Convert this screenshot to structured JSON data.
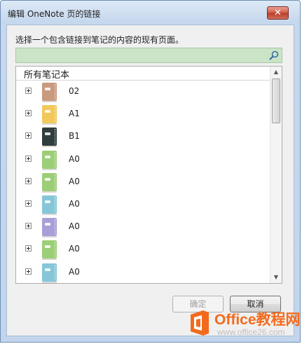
{
  "window": {
    "title": "编辑 OneNote 页的链接",
    "close_label": "✕"
  },
  "dialog": {
    "instruction": "选择一个包含链接到笔记的内容的现有页面。",
    "search": {
      "value": "",
      "placeholder": "",
      "icon": "search-icon"
    },
    "tree": {
      "header": "所有笔记本",
      "items": [
        {
          "label": "02",
          "color": "#c99a7e"
        },
        {
          "label": "A1",
          "color": "#f2c85b"
        },
        {
          "label": "B1",
          "color": "#2f3e3c"
        },
        {
          "label": "A0",
          "color": "#9cce78"
        },
        {
          "label": "A0",
          "color": "#9cce78"
        },
        {
          "label": "A0",
          "color": "#86c6d8"
        },
        {
          "label": "A0",
          "color": "#a99fd6"
        },
        {
          "label": "A0",
          "color": "#9cce78"
        },
        {
          "label": "A0",
          "color": "#86c6d8"
        }
      ]
    },
    "buttons": {
      "ok": "确定",
      "cancel": "取消"
    }
  },
  "watermark": {
    "main": "Office教程网",
    "sub": "www.office26.com",
    "brand_color": "#f26b1d"
  }
}
